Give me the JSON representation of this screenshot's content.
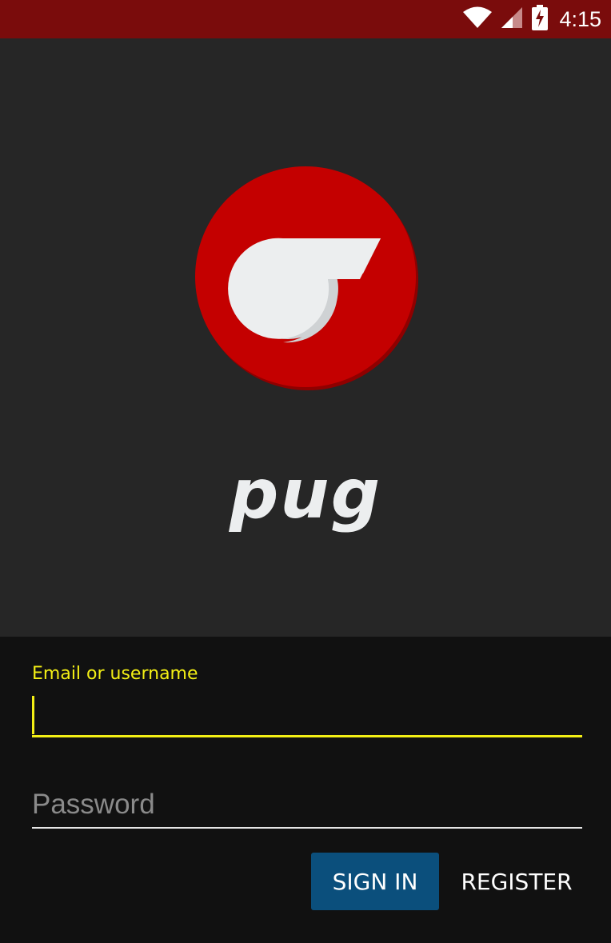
{
  "status_bar": {
    "time": "4:15",
    "icons": [
      "wifi-icon",
      "cellular-signal-icon",
      "battery-charging-icon"
    ],
    "background": "#7a0c0c"
  },
  "hero": {
    "app_name": "pug",
    "logo_icon": "whistle-icon",
    "logo_color": "#c40000",
    "background": "#262626"
  },
  "login_form": {
    "email_label": "Email or username",
    "email_value": "",
    "password_placeholder": "Password",
    "password_value": "",
    "accent_color": "#f3ef15",
    "sign_in_label": "SIGN IN",
    "sign_in_color": "#0b4f7c",
    "register_label": "REGISTER"
  }
}
